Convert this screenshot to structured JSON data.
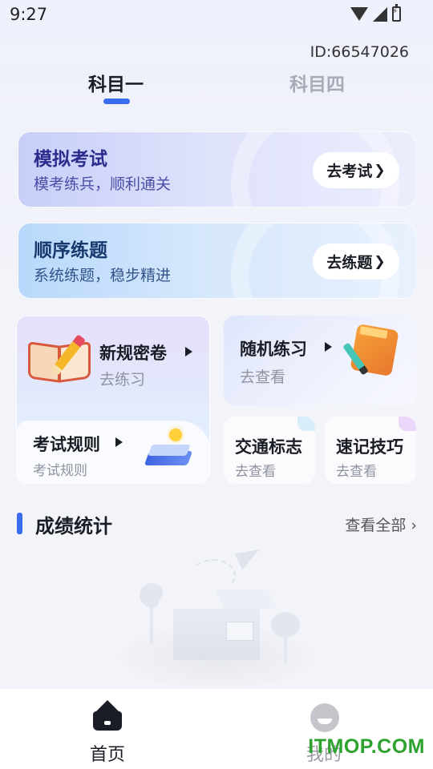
{
  "status_bar": {
    "time": "9:27"
  },
  "header": {
    "user_id": "ID:66547026"
  },
  "tabs": [
    {
      "label": "科目一",
      "active": true
    },
    {
      "label": "科目四",
      "active": false
    }
  ],
  "banners": {
    "exam": {
      "title": "模拟考试",
      "subtitle": "模考练兵，顺利通关",
      "button": "去考试"
    },
    "sequence": {
      "title": "顺序练题",
      "subtitle": "系统练题，稳步精进",
      "button": "去练题"
    }
  },
  "cards": {
    "new_rules": {
      "title": "新规密卷",
      "subtitle": "去练习"
    },
    "random": {
      "title": "随机练习",
      "subtitle": "去查看"
    },
    "exam_rules": {
      "title": "考试规则",
      "subtitle": "考试规则"
    },
    "traffic_signs": {
      "title": "交通标志",
      "subtitle": "去查看"
    },
    "memory_tips": {
      "title": "速记技巧",
      "subtitle": "去查看"
    }
  },
  "scores": {
    "title": "成绩统计",
    "more": "查看全部 ›"
  },
  "bottom_nav": [
    {
      "label": "首页",
      "icon": "home-icon",
      "active": true
    },
    {
      "label": "我的",
      "icon": "profile-icon",
      "active": false
    }
  ],
  "watermark": "ITMOP.COM",
  "colors": {
    "accent": "#3a6cf0",
    "text": "#1b1d26",
    "muted": "#8f93a0"
  }
}
